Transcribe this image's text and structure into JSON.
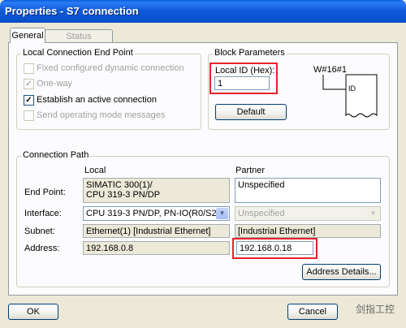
{
  "window": {
    "title": "Properties - S7 connection"
  },
  "tabs": [
    {
      "label": "General",
      "active": true
    },
    {
      "label": "Status Information",
      "active": false
    }
  ],
  "local_endpoint": {
    "title": "Local Connection End Point",
    "options": [
      {
        "label": "Fixed configured dynamic connection",
        "checked": false,
        "enabled": false
      },
      {
        "label": "One-way",
        "checked": true,
        "enabled": false
      },
      {
        "label": "Establish an active connection",
        "checked": true,
        "enabled": true
      },
      {
        "label": "Send operating mode messages",
        "checked": false,
        "enabled": false
      }
    ]
  },
  "block_params": {
    "title": "Block Parameters",
    "local_id_label": "Local ID (Hex):",
    "local_id_value": "1",
    "wid_label": "W#16#1",
    "block_pin_label": "ID",
    "default_button": "Default"
  },
  "connection_path": {
    "title": "Connection Path",
    "col_local": "Local",
    "col_partner": "Partner",
    "end_point_label": "End Point:",
    "end_point_local": "SIMATIC 300(1)/\nCPU 319-3 PN/DP",
    "end_point_partner": "Unspecified",
    "interface_label": "Interface:",
    "interface_local": "CPU 319-3 PN/DP, PN-IO(R0/S2)",
    "interface_partner": "Unspecified",
    "subnet_label": "Subnet:",
    "subnet_local": "Ethernet(1) [Industrial Ethernet]",
    "subnet_partner": "[Industrial Ethernet]",
    "address_label": "Address:",
    "address_local": "192.168.0.8",
    "address_partner": "192.168.0.18",
    "address_details_button": "Address Details..."
  },
  "footer": {
    "ok_button": "OK",
    "cancel_button": "Cancel",
    "watermark": "剑指工控"
  },
  "colors": {
    "highlight": "#e8222a",
    "titlebar": "#0a4ec7"
  }
}
